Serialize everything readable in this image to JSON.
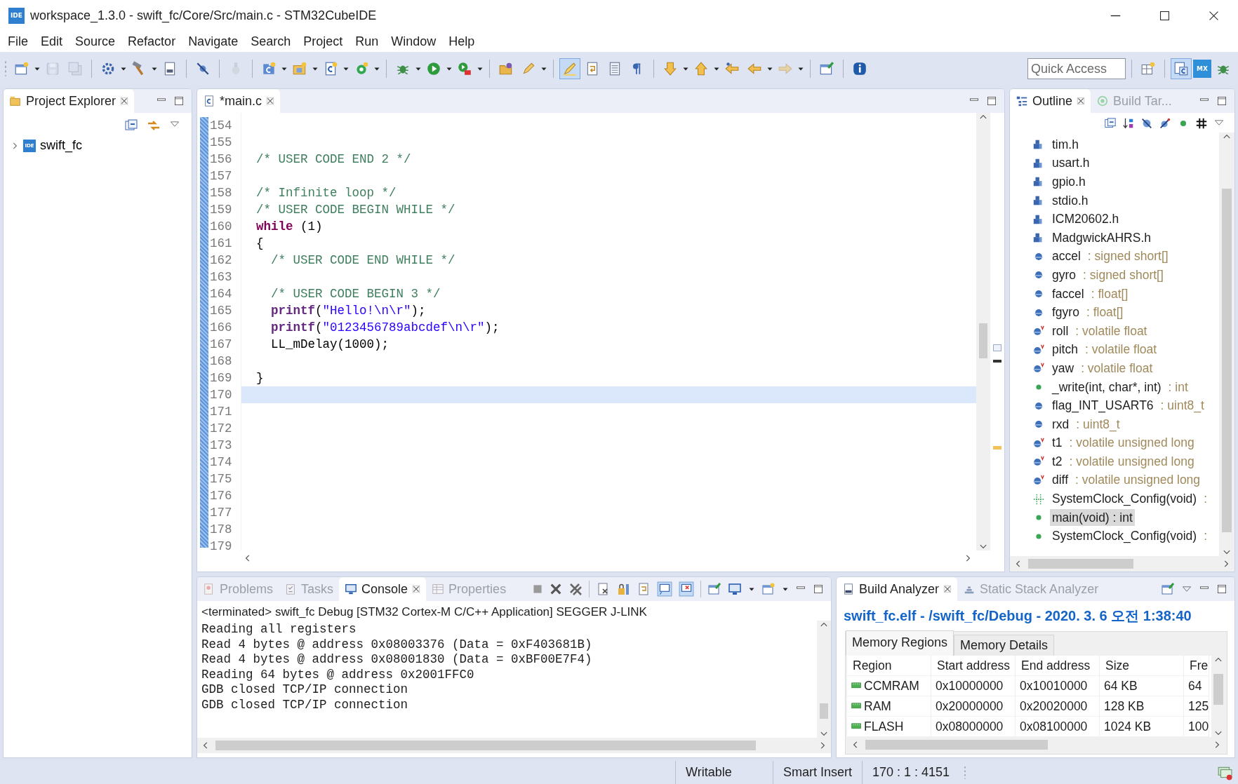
{
  "window": {
    "app_icon_label": "IDE",
    "title": "workspace_1.3.0 - swift_fc/Core/Src/main.c - STM32CubeIDE"
  },
  "menu": [
    "File",
    "Edit",
    "Source",
    "Refactor",
    "Navigate",
    "Search",
    "Project",
    "Run",
    "Window",
    "Help"
  ],
  "toolbar": {
    "groups": [
      [
        {
          "kind": "new",
          "menu": true,
          "selected": false,
          "disabled": false
        },
        {
          "kind": "save",
          "menu": false,
          "selected": false,
          "disabled": true
        },
        {
          "kind": "save-all",
          "menu": false,
          "selected": false,
          "disabled": true
        }
      ],
      [
        {
          "kind": "gear",
          "menu": true,
          "selected": false,
          "disabled": false
        },
        {
          "kind": "hammer",
          "menu": true,
          "selected": false,
          "disabled": false
        },
        {
          "kind": "binary",
          "menu": false,
          "selected": false,
          "disabled": false
        }
      ],
      [
        {
          "kind": "skip",
          "menu": false,
          "selected": false,
          "disabled": false
        }
      ],
      [
        {
          "kind": "plug",
          "menu": false,
          "selected": false,
          "disabled": true
        }
      ],
      [
        {
          "kind": "c-project",
          "menu": true,
          "selected": false,
          "disabled": false
        },
        {
          "kind": "folder",
          "menu": true,
          "selected": false,
          "disabled": false
        },
        {
          "kind": "c-file",
          "menu": true,
          "selected": false,
          "disabled": false
        },
        {
          "kind": "c-class",
          "menu": true,
          "selected": false,
          "disabled": false
        }
      ],
      [
        {
          "kind": "bug",
          "menu": true,
          "selected": false,
          "disabled": false
        },
        {
          "kind": "run",
          "menu": true,
          "selected": false,
          "disabled": false
        },
        {
          "kind": "ext-run",
          "menu": true,
          "selected": false,
          "disabled": false
        }
      ],
      [
        {
          "kind": "open-folder",
          "menu": false,
          "selected": false,
          "disabled": false
        },
        {
          "kind": "pen",
          "menu": true,
          "selected": false,
          "disabled": false
        }
      ],
      [
        {
          "kind": "highlighter",
          "menu": false,
          "selected": true,
          "disabled": false
        },
        {
          "kind": "wrap",
          "menu": false,
          "selected": false,
          "disabled": false
        },
        {
          "kind": "block",
          "menu": false,
          "selected": false,
          "disabled": false
        },
        {
          "kind": "pilcrow",
          "menu": false,
          "selected": false,
          "disabled": false
        }
      ],
      [
        {
          "kind": "next",
          "menu": true,
          "selected": false,
          "disabled": false
        },
        {
          "kind": "prev",
          "menu": true,
          "selected": false,
          "disabled": false
        },
        {
          "kind": "last-edit",
          "menu": false,
          "selected": false,
          "disabled": false
        },
        {
          "kind": "back",
          "menu": true,
          "selected": false,
          "disabled": false
        },
        {
          "kind": "forward",
          "menu": true,
          "selected": false,
          "disabled": true
        }
      ],
      [
        {
          "kind": "pin",
          "menu": false,
          "selected": false,
          "disabled": false
        }
      ],
      [
        {
          "kind": "info",
          "menu": false,
          "selected": false,
          "disabled": false
        }
      ]
    ],
    "quick_access": {
      "placeholder": "Quick Access"
    },
    "perspectives": [
      {
        "kind": "open-perspective",
        "selected": false
      },
      {
        "kind": "c-cpp",
        "selected": true
      },
      {
        "kind": "device-config",
        "label": "MX",
        "selected": false
      },
      {
        "kind": "debug",
        "selected": false
      }
    ]
  },
  "project_explorer": {
    "tabs": [
      {
        "kind": "project-explorer",
        "label": "Project Explorer",
        "selected": true
      }
    ],
    "tree": [
      {
        "label": "swift_fc",
        "icon_label": "IDE",
        "expanded": false
      }
    ]
  },
  "editor": {
    "tabs": [
      {
        "kind": "c-file",
        "label": "*main.c",
        "selected": true
      }
    ],
    "lines": [
      {
        "number": "154",
        "current": false
      },
      {
        "number": "155",
        "current": false
      },
      {
        "number": "156",
        "current": false,
        "segments": [
          {
            "kind": "comment",
            "text": "/* USER CODE END 2 */"
          }
        ]
      },
      {
        "number": "157",
        "current": false
      },
      {
        "number": "158",
        "current": false,
        "segments": [
          {
            "kind": "comment",
            "text": "/* Infinite loop */"
          }
        ]
      },
      {
        "number": "159",
        "current": false,
        "segments": [
          {
            "kind": "comment",
            "text": "/* USER CODE BEGIN WHILE */"
          }
        ]
      },
      {
        "number": "160",
        "current": false,
        "segments": [
          {
            "kind": "keyword",
            "text": "while"
          },
          {
            "kind": "plain",
            "text": " (1)"
          }
        ]
      },
      {
        "number": "161",
        "current": false,
        "segments": [
          {
            "kind": "plain",
            "text": "{"
          }
        ]
      },
      {
        "number": "162",
        "current": false,
        "segments": [
          {
            "kind": "comment",
            "text": "  /* USER CODE END WHILE */"
          }
        ]
      },
      {
        "number": "163",
        "current": false
      },
      {
        "number": "164",
        "current": false,
        "segments": [
          {
            "kind": "comment",
            "text": "  /* USER CODE BEGIN 3 */"
          }
        ]
      },
      {
        "number": "165",
        "current": false,
        "segments": [
          {
            "kind": "function",
            "text": "  printf"
          },
          {
            "kind": "plain",
            "text": "("
          },
          {
            "kind": "string",
            "text": "\"Hello!\\n\\r\""
          },
          {
            "kind": "plain",
            "text": ");"
          }
        ]
      },
      {
        "number": "166",
        "current": false,
        "segments": [
          {
            "kind": "function",
            "text": "  printf"
          },
          {
            "kind": "plain",
            "text": "("
          },
          {
            "kind": "string",
            "text": "\"0123456789abcdef\\n\\r\""
          },
          {
            "kind": "plain",
            "text": ");"
          }
        ]
      },
      {
        "number": "167",
        "current": false,
        "segments": [
          {
            "kind": "plain",
            "text": "  LL_mDelay(1000);"
          }
        ]
      },
      {
        "number": "168",
        "current": false
      },
      {
        "number": "169",
        "current": false,
        "segments": [
          {
            "kind": "plain",
            "text": "}"
          }
        ]
      },
      {
        "number": "170",
        "current": true
      },
      {
        "number": "171",
        "current": false
      },
      {
        "number": "172",
        "current": false
      },
      {
        "number": "173",
        "current": false
      },
      {
        "number": "174",
        "current": false
      },
      {
        "number": "175",
        "current": false
      },
      {
        "number": "176",
        "current": false
      },
      {
        "number": "177",
        "current": false
      },
      {
        "number": "178",
        "current": false
      },
      {
        "number": "179",
        "current": false
      }
    ]
  },
  "outline": {
    "tabs": [
      {
        "kind": "outline",
        "label": "Outline",
        "selected": true
      },
      {
        "kind": "build-targets",
        "label": "Build Tar...",
        "selected": false
      }
    ],
    "items": [
      {
        "kind": "include",
        "name": "tim.h",
        "selected": false
      },
      {
        "kind": "include",
        "name": "usart.h",
        "selected": false
      },
      {
        "kind": "include",
        "name": "gpio.h",
        "selected": false
      },
      {
        "kind": "include",
        "name": "stdio.h",
        "selected": false
      },
      {
        "kind": "include",
        "name": "ICM20602.h",
        "selected": false
      },
      {
        "kind": "include",
        "name": "MadgwickAHRS.h",
        "selected": false
      },
      {
        "kind": "field",
        "name": "accel",
        "type": ": signed short[]",
        "selected": false
      },
      {
        "kind": "field",
        "name": "gyro",
        "type": ": signed short[]",
        "selected": false
      },
      {
        "kind": "field",
        "name": "faccel",
        "type": ": float[]",
        "selected": false
      },
      {
        "kind": "field",
        "name": "fgyro",
        "type": ": float[]",
        "selected": false
      },
      {
        "kind": "volatile",
        "name": "roll",
        "type": ": volatile float",
        "selected": false
      },
      {
        "kind": "volatile",
        "name": "pitch",
        "type": ": volatile float",
        "selected": false
      },
      {
        "kind": "volatile",
        "name": "yaw",
        "type": ": volatile float",
        "selected": false
      },
      {
        "kind": "function",
        "name": "_write(int, char*, int)",
        "type": ": int",
        "selected": false
      },
      {
        "kind": "field",
        "name": "flag_INT_USART6",
        "type": ": uint8_t",
        "selected": false
      },
      {
        "kind": "field",
        "name": "rxd",
        "type": ": uint8_t",
        "selected": false
      },
      {
        "kind": "volatile",
        "name": "t1",
        "type": ": volatile unsigned long",
        "selected": false
      },
      {
        "kind": "volatile",
        "name": "t2",
        "type": ": volatile unsigned long",
        "selected": false
      },
      {
        "kind": "volatile",
        "name": "diff",
        "type": ": volatile unsigned long",
        "selected": false
      },
      {
        "kind": "declaration",
        "name": "SystemClock_Config(void)",
        "type": ":",
        "selected": false
      },
      {
        "kind": "function",
        "name": "main(void) : int",
        "selected": true
      },
      {
        "kind": "function",
        "name": "SystemClock_Config(void)",
        "type": ":",
        "selected": false
      }
    ]
  },
  "console": {
    "tabs": [
      {
        "kind": "problems",
        "label": "Problems",
        "selected": false
      },
      {
        "kind": "tasks",
        "label": "Tasks",
        "selected": false
      },
      {
        "kind": "console",
        "label": "Console",
        "selected": true
      },
      {
        "kind": "properties",
        "label": "Properties",
        "selected": false
      }
    ],
    "header": "<terminated> swift_fc Debug [STM32 Cortex-M C/C++ Application] SEGGER J-LINK",
    "lines": [
      "Reading all registers",
      "Read 4 bytes @ address 0x08003376 (Data = 0xF403681B)",
      "Read 4 bytes @ address 0x08001830 (Data = 0xBF00E7F4)",
      "Reading 64 bytes @ address 0x2001FFC0",
      "GDB closed TCP/IP connection",
      "GDB closed TCP/IP connection"
    ]
  },
  "build_analyzer": {
    "tabs": [
      {
        "kind": "build-analyzer",
        "label": "Build Analyzer",
        "selected": true
      },
      {
        "kind": "stack-analyzer",
        "label": "Static Stack Analyzer",
        "selected": false
      }
    ],
    "title": "swift_fc.elf - /swift_fc/Debug - 2020. 3. 6 오전 1:38:40",
    "subtabs": [
      {
        "label": "Memory Regions",
        "selected": true
      },
      {
        "label": "Memory Details",
        "selected": false
      }
    ],
    "columns": [
      "Region",
      "Start address",
      "End address",
      "Size",
      "Fre"
    ],
    "rows": [
      [
        "CCMRAM",
        "0x10000000",
        "0x10010000",
        "64 KB",
        "64"
      ],
      [
        "RAM",
        "0x20000000",
        "0x20020000",
        "128 KB",
        "125"
      ],
      [
        "FLASH",
        "0x08000000",
        "0x08100000",
        "1024 KB",
        "100"
      ]
    ]
  },
  "status_bar": [
    "Writable",
    "Smart Insert",
    "170 : 1 : 4151"
  ]
}
